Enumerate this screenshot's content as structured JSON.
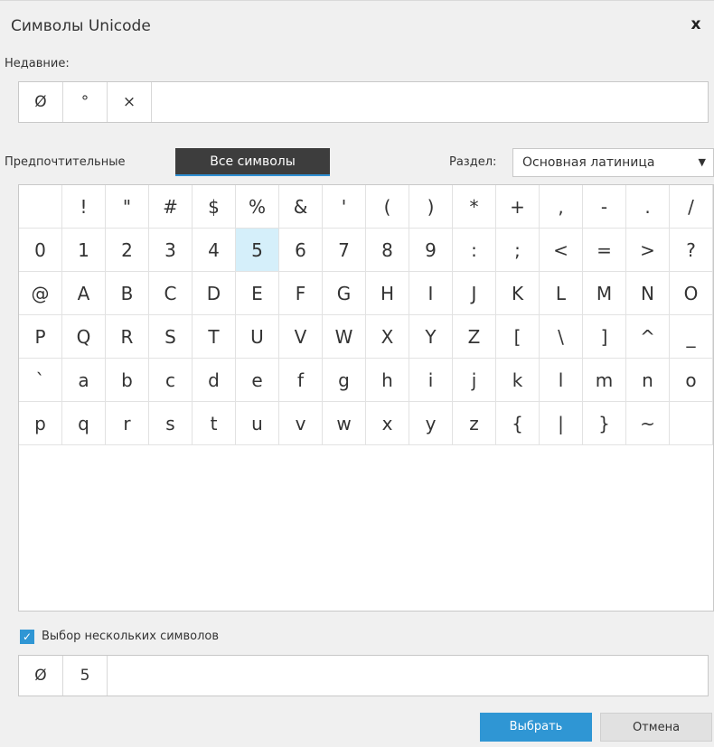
{
  "window": {
    "title": "Символы Unicode",
    "close_glyph": "x"
  },
  "recent": {
    "label": "Недавние:",
    "items": [
      "Ø",
      "°",
      "×"
    ]
  },
  "modes": {
    "preferred_label": "Предпочтительные",
    "all_label": "Все символы"
  },
  "section": {
    "label": "Раздел:",
    "value": "Основная латиница"
  },
  "grid": {
    "selected_char": "5",
    "rows": [
      [
        " ",
        "!",
        "\"",
        "#",
        "$",
        "%",
        "&",
        "'",
        "(",
        ")",
        "*",
        "+",
        ",",
        "-",
        ".",
        "/"
      ],
      [
        "0",
        "1",
        "2",
        "3",
        "4",
        "5",
        "6",
        "7",
        "8",
        "9",
        ":",
        ";",
        "<",
        "=",
        ">",
        "?"
      ],
      [
        "@",
        "A",
        "B",
        "C",
        "D",
        "E",
        "F",
        "G",
        "H",
        "I",
        "J",
        "K",
        "L",
        "M",
        "N",
        "O"
      ],
      [
        "P",
        "Q",
        "R",
        "S",
        "T",
        "U",
        "V",
        "W",
        "X",
        "Y",
        "Z",
        "[",
        "\\",
        "]",
        "^",
        "_"
      ],
      [
        "`",
        "a",
        "b",
        "c",
        "d",
        "e",
        "f",
        "g",
        "h",
        "i",
        "j",
        "k",
        "l",
        "m",
        "n",
        "o"
      ],
      [
        "p",
        "q",
        "r",
        "s",
        "t",
        "u",
        "v",
        "w",
        "x",
        "y",
        "z",
        "{",
        "|",
        "}",
        "~",
        ""
      ]
    ]
  },
  "multi_select": {
    "label": "Выбор нескольких символов",
    "checked": true
  },
  "selected": {
    "items": [
      "Ø",
      "5"
    ]
  },
  "buttons": {
    "ok": "Выбрать",
    "cancel": "Отмена"
  },
  "colors": {
    "accent": "#2f96d4",
    "selected_cell": "#d5effa",
    "active_tab": "#3d3d3d"
  }
}
